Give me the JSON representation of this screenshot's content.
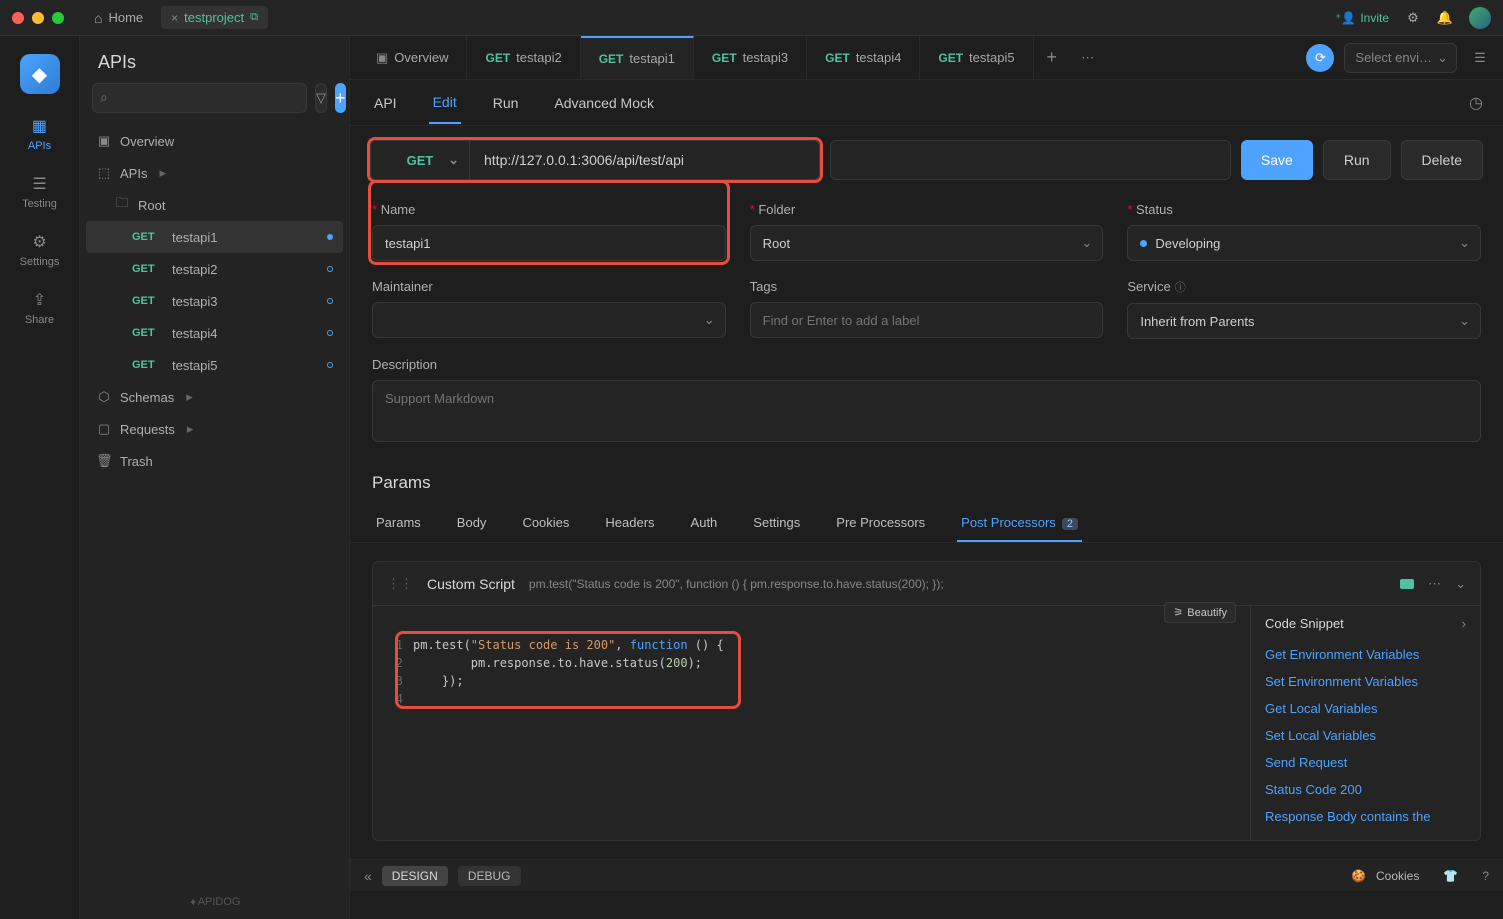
{
  "titlebar": {
    "home": "Home",
    "project": "testproject",
    "invite": "Invite"
  },
  "rail": {
    "items": [
      {
        "label": "APIs"
      },
      {
        "label": "Testing"
      },
      {
        "label": "Settings"
      },
      {
        "label": "Share"
      }
    ]
  },
  "sidebar": {
    "title": "APIs",
    "search_placeholder": "",
    "overview": "Overview",
    "apis_label": "APIs",
    "root_label": "Root",
    "items": [
      {
        "method": "GET",
        "name": "testapi1",
        "selected": true,
        "dot": "solid"
      },
      {
        "method": "GET",
        "name": "testapi2",
        "selected": false,
        "dot": "hollow"
      },
      {
        "method": "GET",
        "name": "testapi3",
        "selected": false,
        "dot": "hollow"
      },
      {
        "method": "GET",
        "name": "testapi4",
        "selected": false,
        "dot": "hollow"
      },
      {
        "method": "GET",
        "name": "testapi5",
        "selected": false,
        "dot": "hollow"
      }
    ],
    "schemas": "Schemas",
    "requests": "Requests",
    "trash": "Trash",
    "brand": "APIDOG"
  },
  "tabs": {
    "overview": "Overview",
    "items": [
      {
        "method": "GET",
        "name": "testapi2"
      },
      {
        "method": "GET",
        "name": "testapi1"
      },
      {
        "method": "GET",
        "name": "testapi3"
      },
      {
        "method": "GET",
        "name": "testapi4"
      },
      {
        "method": "GET",
        "name": "testapi5"
      }
    ],
    "env_placeholder": "Select envi…"
  },
  "subtabs": {
    "api": "API",
    "edit": "Edit",
    "run": "Run",
    "mock": "Advanced Mock"
  },
  "request": {
    "method": "GET",
    "url": "http://127.0.0.1:3006/api/test/api",
    "save": "Save",
    "run": "Run",
    "delete": "Delete"
  },
  "fields": {
    "name_label": "Name",
    "name_value": "testapi1",
    "folder_label": "Folder",
    "folder_value": "Root",
    "status_label": "Status",
    "status_value": "Developing",
    "maintainer_label": "Maintainer",
    "tags_label": "Tags",
    "tags_placeholder": "Find or Enter to add a label",
    "service_label": "Service",
    "service_value": "Inherit from Parents",
    "description_label": "Description",
    "description_placeholder": "Support Markdown"
  },
  "params": {
    "heading": "Params",
    "tabs": {
      "params": "Params",
      "body": "Body",
      "cookies": "Cookies",
      "headers": "Headers",
      "auth": "Auth",
      "settings": "Settings",
      "pre": "Pre Processors",
      "post": "Post Processors",
      "post_count": "2"
    }
  },
  "script": {
    "title": "Custom Script",
    "preview": "pm.test(\"Status code is 200\", function () { pm.response.to.have.status(200); });",
    "beautify": "Beautify",
    "code": {
      "l1a": "pm.test(",
      "l1b": "\"Status code is 200\"",
      "l1c": ", ",
      "l1d": "function",
      "l1e": " () {",
      "l2a": "        pm.response.to.have.status(",
      "l2b": "200",
      "l2c": ");",
      "l3": "    });",
      "l4": ""
    }
  },
  "snippets": {
    "heading": "Code Snippet",
    "items": [
      "Get Environment Variables",
      "Set Environment Variables",
      "Get Local Variables",
      "Set Local Variables",
      "Send Request",
      "Status Code 200",
      "Response Body contains the"
    ]
  },
  "footer": {
    "design": "DESIGN",
    "debug": "DEBUG",
    "cookies": "Cookies"
  }
}
